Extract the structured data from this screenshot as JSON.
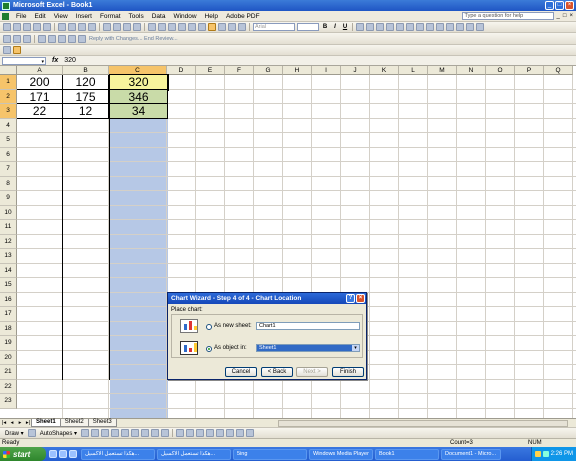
{
  "window": {
    "title": "Microsoft Excel - Book1"
  },
  "menu": {
    "items": [
      "File",
      "Edit",
      "View",
      "Insert",
      "Format",
      "Tools",
      "Data",
      "Window",
      "Help",
      "Adobe PDF"
    ],
    "help_placeholder": "Type a question for help"
  },
  "toolbar": {
    "review_text": "Reply with Changes...  End Review...",
    "font_name": "Arial",
    "font_size": "10"
  },
  "formula": {
    "name_box": "",
    "fx": "fx",
    "value": "320"
  },
  "grid": {
    "columns": [
      "A",
      "B",
      "C",
      "D",
      "E",
      "F",
      "G",
      "H",
      "I",
      "J",
      "K",
      "L",
      "M",
      "N",
      "O",
      "P",
      "Q"
    ],
    "rows": [
      "1",
      "2",
      "3",
      "4",
      "5",
      "6",
      "7",
      "8",
      "9",
      "10",
      "11",
      "12",
      "13",
      "14",
      "15",
      "16",
      "17",
      "18",
      "19",
      "20",
      "21",
      "22",
      "23"
    ],
    "data": [
      [
        "200",
        "120",
        "320"
      ],
      [
        "171",
        "175",
        "346"
      ],
      [
        "22",
        "12",
        "34"
      ]
    ]
  },
  "sheets": [
    "Sheet1",
    "Sheet2",
    "Sheet3"
  ],
  "draw": {
    "draw_label": "Draw ▾",
    "autoshapes_label": "AutoShapes ▾"
  },
  "status": {
    "left": "Ready",
    "sum": "Count=3",
    "num": "NUM"
  },
  "taskbar": {
    "start": "start",
    "tasks": [
      "هكذا تستعمل الاكسيل...",
      "هكذا تستعمل الاكسيل...",
      "5ing",
      "Windows Media Player",
      "Book1",
      "Document1 - Micro..."
    ],
    "clock": "2:26 PM"
  },
  "dialog": {
    "title": "Chart Wizard - Step 4 of 4 - Chart Location",
    "place_chart": "Place chart:",
    "option_new_sheet": "As new sheet:",
    "new_sheet_value": "Chart1",
    "option_object_in": "As object in:",
    "object_in_value": "Sheet1",
    "buttons": {
      "cancel": "Cancel",
      "back": "< Back",
      "next": "Next >",
      "finish": "Finish"
    }
  },
  "colors": {
    "selection": "#b6c8e6",
    "highlight": "#f6c46a",
    "title": "#1f55c4"
  }
}
